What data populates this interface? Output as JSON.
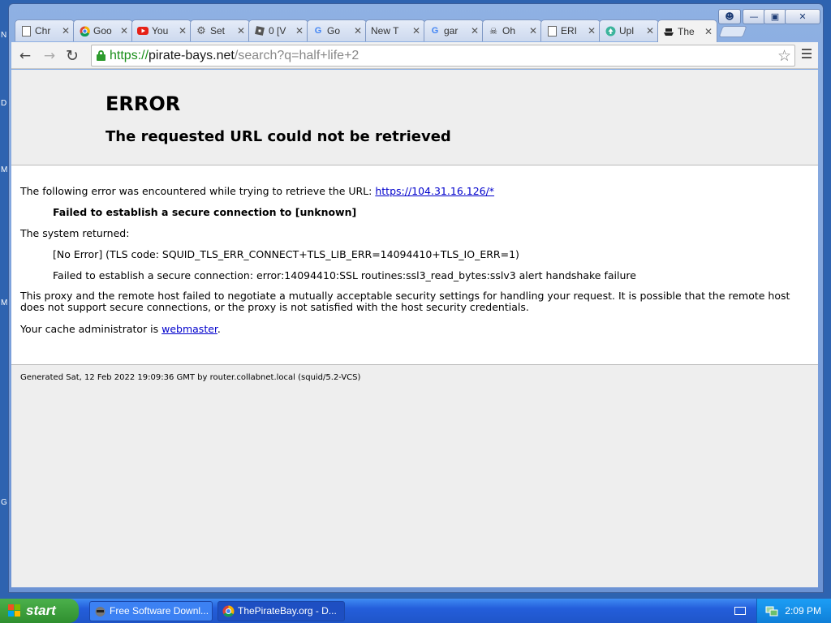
{
  "desktop": {
    "edge_letters": [
      "N",
      "D",
      "M",
      "M",
      "G"
    ]
  },
  "browser": {
    "tabs": [
      {
        "title": "Chr",
        "icon": "document-icon"
      },
      {
        "title": "Goo",
        "icon": "chrome-icon"
      },
      {
        "title": "You",
        "icon": "youtube-icon"
      },
      {
        "title": "Set",
        "icon": "gear-icon"
      },
      {
        "title": "0 [V",
        "icon": "roblox-icon"
      },
      {
        "title": "Go",
        "icon": "google-icon"
      },
      {
        "title": "New T",
        "icon": ""
      },
      {
        "title": "gar",
        "icon": "google-icon"
      },
      {
        "title": "Oh",
        "icon": "pirate-icon"
      },
      {
        "title": "ERI",
        "icon": "document-icon"
      },
      {
        "title": "Upl",
        "icon": "upload-icon"
      },
      {
        "title": "The",
        "icon": "pirate-ship-icon"
      }
    ],
    "active_tab_index": 11,
    "url_scheme": "https://",
    "url_host": "pirate-bays.net",
    "url_path": "/search?q=half+life+2"
  },
  "page": {
    "heading": "ERROR",
    "subheading": "The requested URL could not be retrieved",
    "line1_prefix": "The following error was encountered while trying to retrieve the URL: ",
    "line1_link": "https://104.31.16.126/*",
    "failed_bold": "Failed to establish a secure connection to [unknown]",
    "system_returned": "The system returned:",
    "no_error": "[No Error] (TLS code: SQUID_TLS_ERR_CONNECT+TLS_LIB_ERR=14094410+TLS_IO_ERR=1)",
    "ssl_detail": "Failed to establish a secure connection: error:14094410:SSL routines:ssl3_read_bytes:sslv3 alert handshake failure",
    "proxy_text": "This proxy and the remote host failed to negotiate a mutually acceptable security settings for handling your request. It is possible that the remote host does not support secure connections, or the proxy is not satisfied with the host security credentials.",
    "admin_prefix": "Your cache administrator is ",
    "admin_link": "webmaster",
    "admin_suffix": ".",
    "footer": "Generated Sat, 12 Feb 2022 19:09:36 GMT by router.collabnet.local (squid/5.2-VCS)"
  },
  "taskbar": {
    "start_label": "start",
    "buttons": [
      {
        "label": "Free Software Downl...",
        "icon": "raccoon-icon"
      },
      {
        "label": "ThePirateBay.org - D...",
        "icon": "chrome-icon"
      }
    ],
    "clock": "2:09 PM"
  },
  "colors": {
    "url_secure": "#1a8f1a",
    "link": "#0000cc",
    "taskbar": "#245edb",
    "start": "#2f8f2f"
  }
}
